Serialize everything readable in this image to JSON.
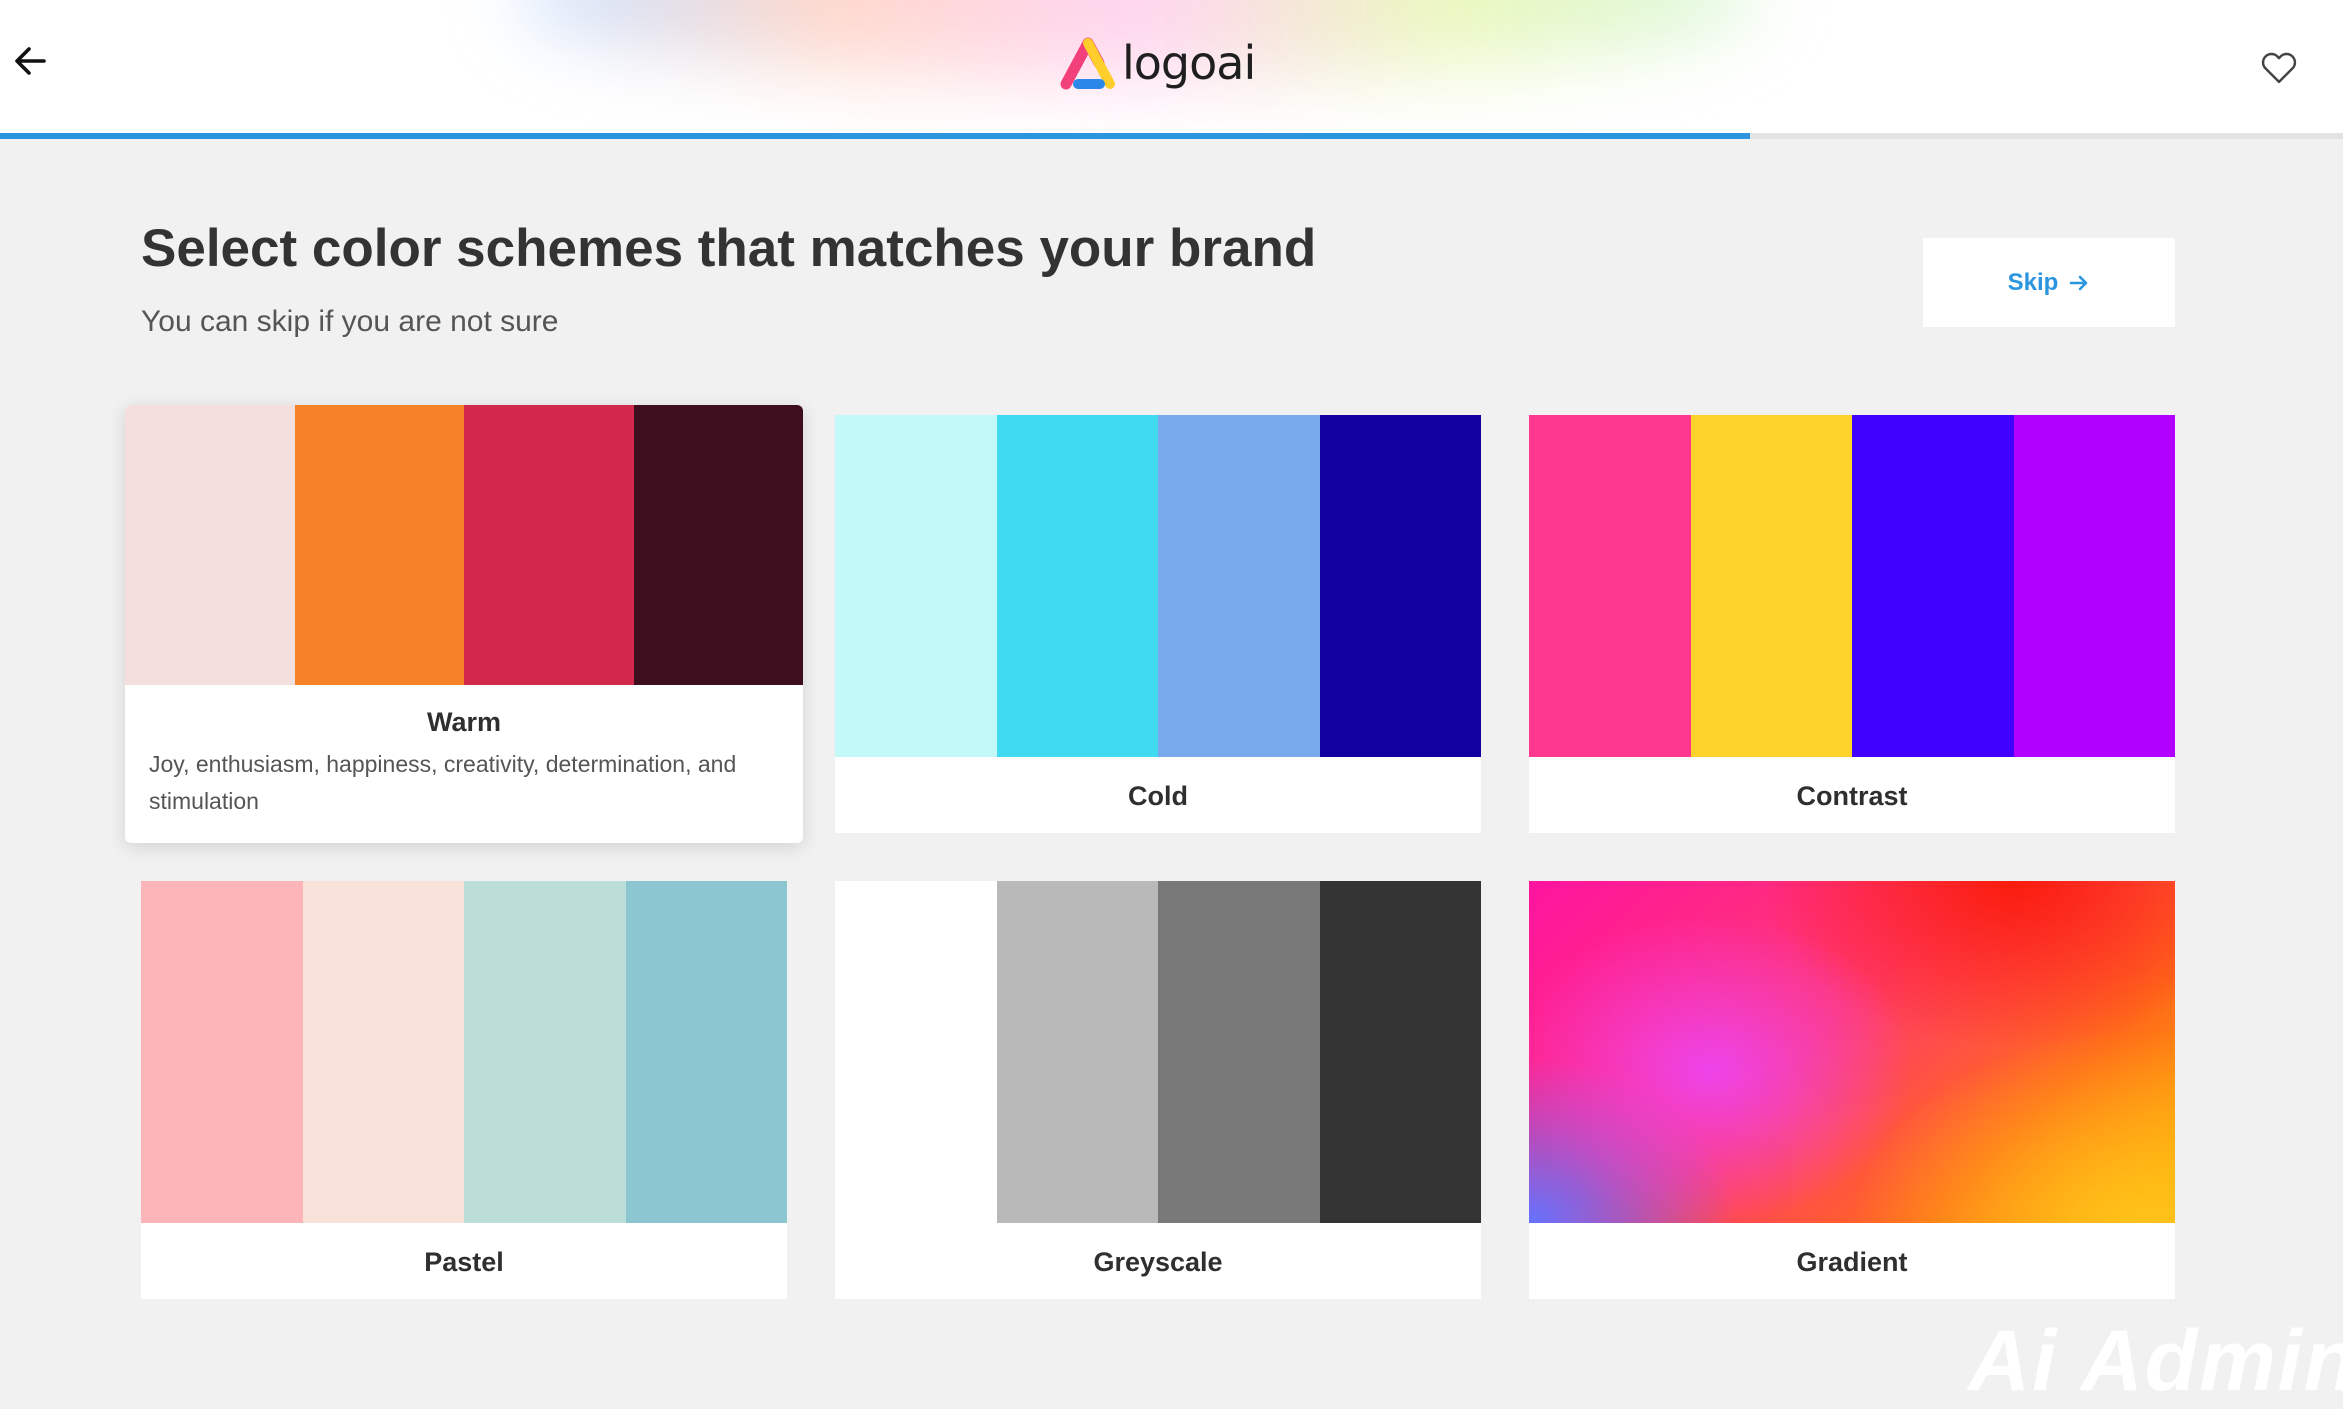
{
  "header": {
    "logo_text": "logoai",
    "back_icon": "arrow-left-icon",
    "favorite_icon": "heart-icon",
    "progress": 0.747
  },
  "page": {
    "title": "Select color schemes that matches your brand",
    "subtitle": "You can skip if you are not sure",
    "skip_label": "Skip",
    "skip_icon": "arrow-right-icon"
  },
  "schemes": [
    {
      "name": "Warm",
      "description": "Joy, enthusiasm, happiness, creativity, determination, and stimulation",
      "colors": [
        "#f3e0de",
        "#f78127",
        "#d2284c",
        "#3d0e1d"
      ],
      "selected": true
    },
    {
      "name": "Cold",
      "description": "",
      "colors": [
        "#c3f9f9",
        "#40dbf0",
        "#79a9ed",
        "#1200a0"
      ],
      "selected": false
    },
    {
      "name": "Contrast",
      "description": "",
      "colors": [
        "#ff388f",
        "#fed32a",
        "#4001ff",
        "#b100ff"
      ],
      "selected": false
    },
    {
      "name": "Pastel",
      "description": "",
      "colors": [
        "#feb5b9",
        "#f9e2da",
        "#bbdfd8",
        "#8cc6d0"
      ],
      "selected": false
    },
    {
      "name": "Greyscale",
      "description": "",
      "colors": [
        "#ffffff",
        "#b9b9b9",
        "#797979",
        "#333333"
      ],
      "selected": false
    },
    {
      "name": "Gradient",
      "description": "",
      "colors": [
        "#ff14a0",
        "#fb1c0c",
        "#ffc21a",
        "#6472ff"
      ],
      "selected": false
    }
  ],
  "watermark": "Ai Admin"
}
